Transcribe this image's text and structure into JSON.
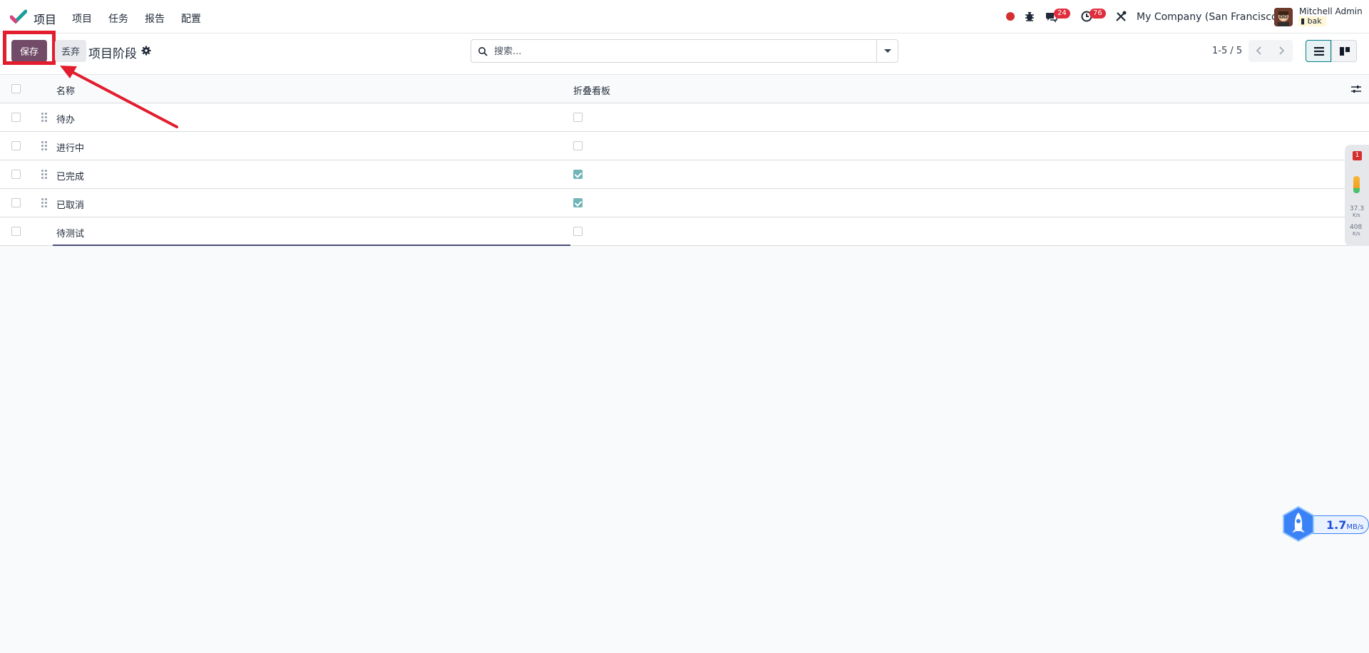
{
  "navbar": {
    "app_name": "项目",
    "menu": [
      "项目",
      "任务",
      "报告",
      "配置"
    ],
    "messages_badge": "24",
    "activity_badge": "76",
    "company": "My Company (San Francisco)",
    "user_name": "Mitchell Admin",
    "db_name": "bak"
  },
  "control_panel": {
    "save_label": "保存",
    "discard_label": "丢弃",
    "breadcrumb": "项目阶段",
    "search_placeholder": "搜索...",
    "pager": "1-5 / 5"
  },
  "table": {
    "columns": [
      "名称",
      "折叠看板"
    ],
    "rows": [
      {
        "name": "待办",
        "folded": false
      },
      {
        "name": "进行中",
        "folded": false
      },
      {
        "name": "已完成",
        "folded": true
      },
      {
        "name": "已取消",
        "folded": true
      },
      {
        "name": "待测试",
        "folded": false
      }
    ]
  },
  "widgets": {
    "side_badge": "1",
    "upload_speed": "37.3",
    "speed_unit_small": "K/s",
    "download_speed": "408",
    "net_speed": "1.7",
    "net_speed_unit": "MB/s"
  },
  "colors": {
    "primary": "#714b67",
    "highlight": "#e11d2e",
    "checkbox_checked": "#71b5b8",
    "badge": "#e02d3c"
  }
}
